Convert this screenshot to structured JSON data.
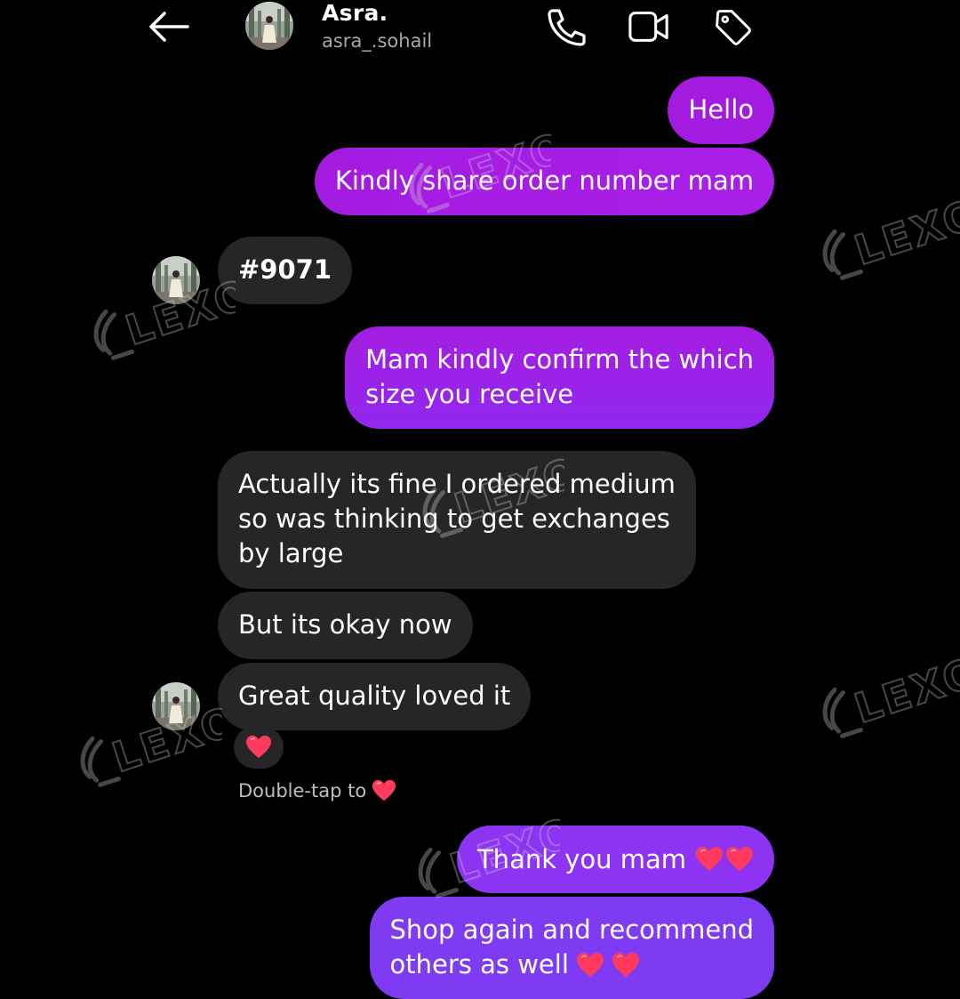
{
  "header": {
    "name": "Asra.",
    "username": "asra_.sohail",
    "icons": [
      "back-arrow-icon",
      "phone-icon",
      "video-camera-icon",
      "tag-icon"
    ]
  },
  "messages": [
    {
      "from": "me",
      "text": "Hello"
    },
    {
      "from": "me",
      "text": "Kindly share order number mam"
    },
    {
      "from": "them",
      "text": "#9071"
    },
    {
      "from": "me",
      "lines": [
        "Mam kindly confirm the which",
        "size you receive"
      ]
    },
    {
      "from": "them",
      "lines": [
        "Actually its fine I ordered medium",
        "so was thinking to get exchanges",
        "by large"
      ]
    },
    {
      "from": "them",
      "text": "But its okay now"
    },
    {
      "from": "them",
      "text": "Great quality loved it"
    },
    {
      "from": "me",
      "text": "Thank you mam"
    },
    {
      "from": "me",
      "lines": [
        "Shop again and recommend",
        "others as well"
      ]
    }
  ],
  "reaction": {
    "emoji": "heart-icon"
  },
  "hint": {
    "text": "Double-tap to"
  },
  "watermark": {
    "text": "LEXO"
  },
  "colors": {
    "background": "#000000",
    "outgoing_bubble": "#a41be0",
    "outgoing_bubble_late": "#7e3bf2",
    "incoming_bubble": "#262626",
    "heart": "#ff3a5c"
  }
}
